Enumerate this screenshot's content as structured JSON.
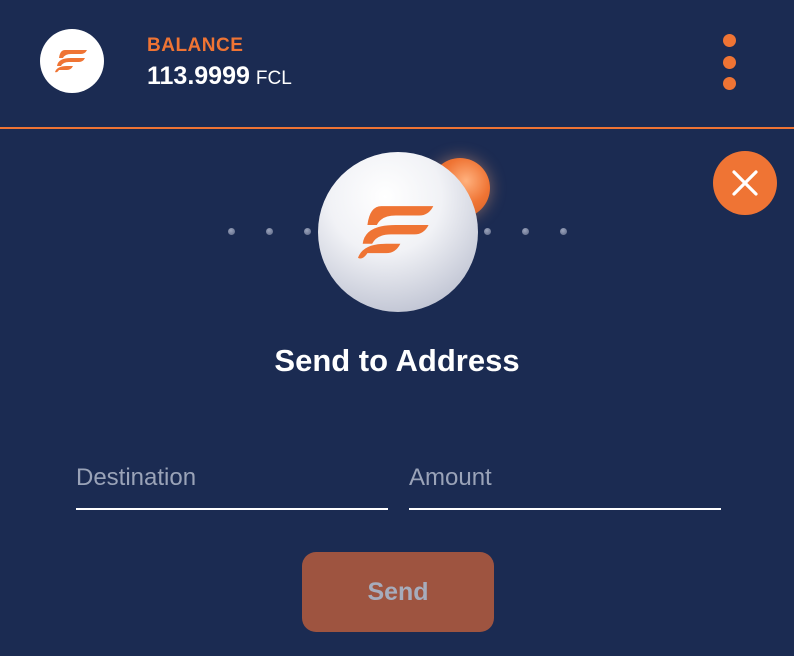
{
  "header": {
    "balance_label": "BALANCE",
    "balance_amount": "113.9999",
    "balance_unit": "FCL",
    "logo_icon": "flow-logo-icon",
    "menu_icon": "kebab-menu-icon"
  },
  "dialog": {
    "title": "Send to Address",
    "close_icon": "close-icon",
    "destination": {
      "placeholder": "Destination",
      "value": ""
    },
    "amount": {
      "placeholder": "Amount",
      "value": ""
    },
    "send_label": "Send",
    "send_enabled": false
  },
  "colors": {
    "background": "#1b2b52",
    "accent": "#ef7434",
    "send_disabled": "#9e5440",
    "placeholder": "#9aa3b8"
  }
}
